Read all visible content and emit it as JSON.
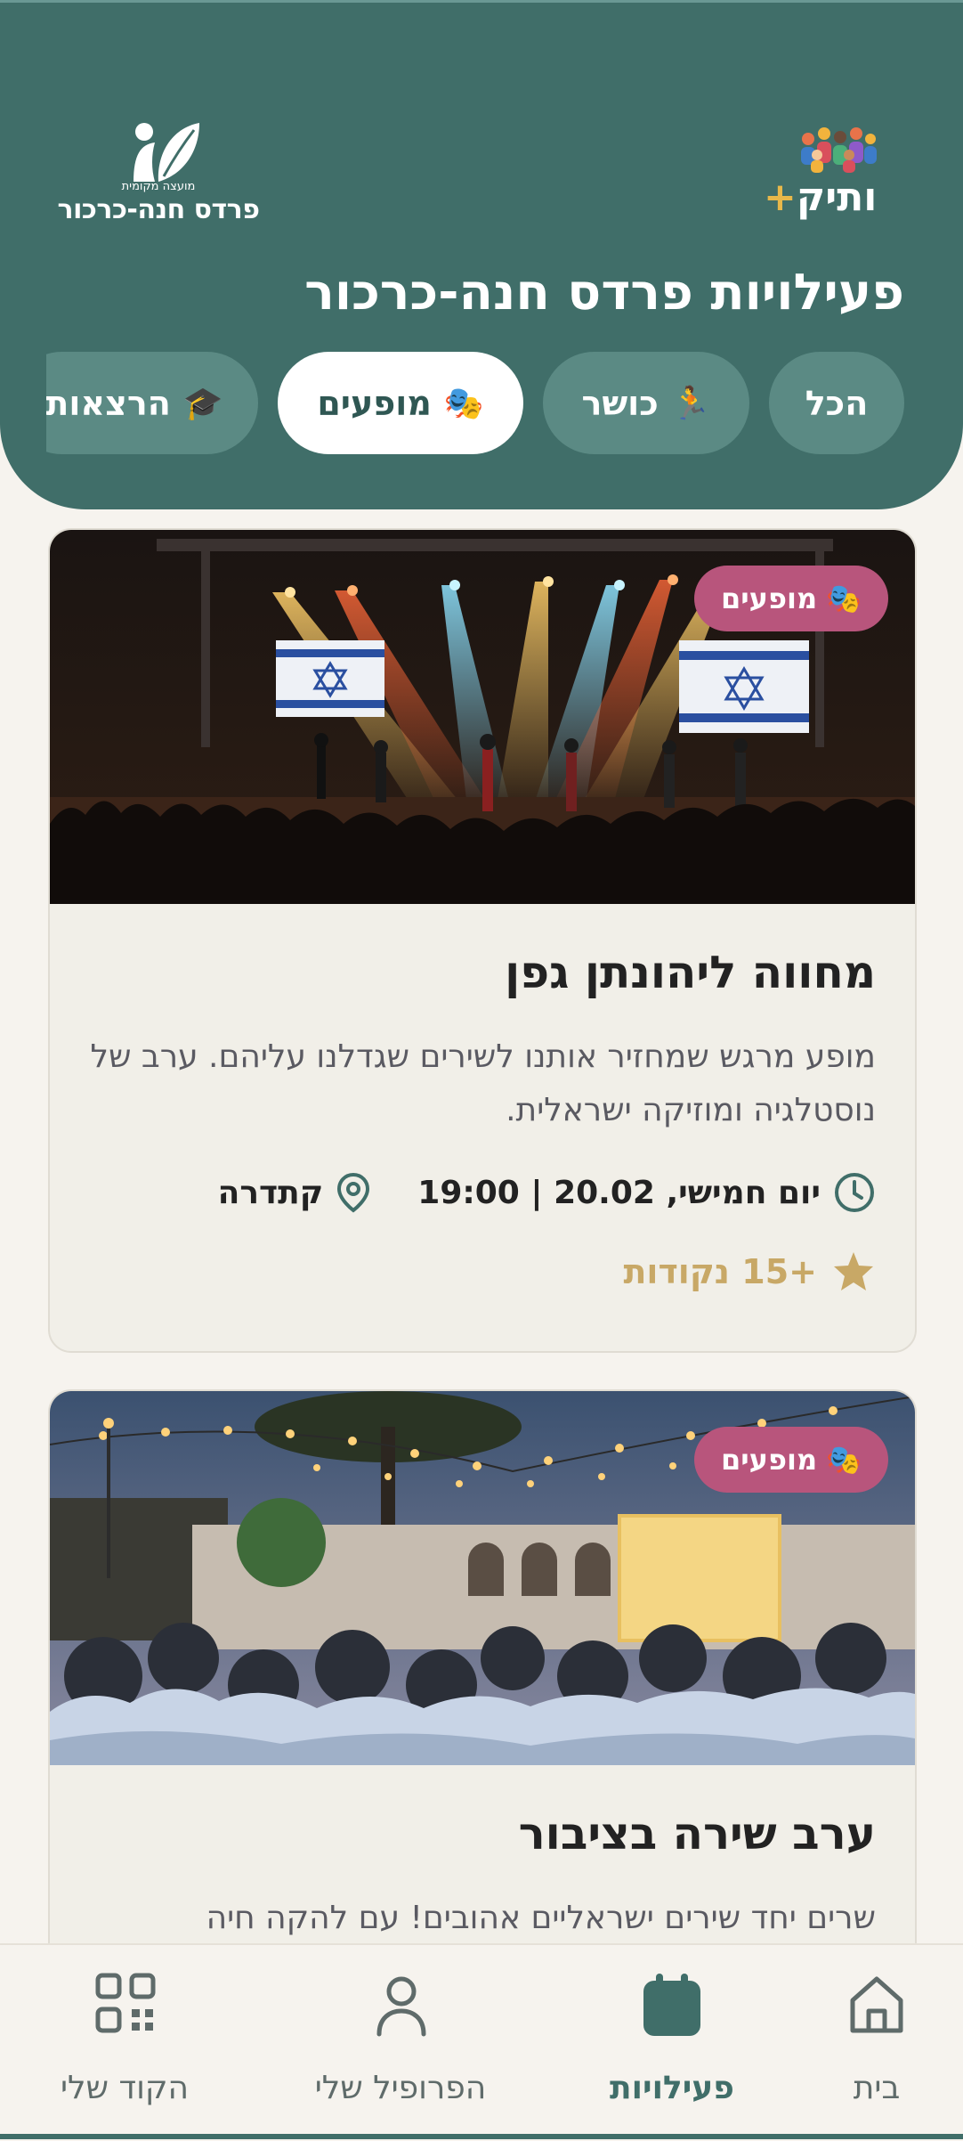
{
  "header": {
    "title": "פעילויות פרדס חנה-כרכור",
    "logo_vatik": {
      "text": "ותיק",
      "plus": "+"
    },
    "logo_council": {
      "small_text": "מועצה מקומית",
      "name": "פרדס חנה-כרכור"
    }
  },
  "filters": [
    {
      "label": "הכל",
      "icon": "",
      "active": false
    },
    {
      "label": "כושר",
      "icon": "🏃",
      "active": false
    },
    {
      "label": "מופעים",
      "icon": "🎭",
      "active": true
    },
    {
      "label": "הרצאות",
      "icon": "🎓",
      "active": false
    }
  ],
  "events": [
    {
      "badge_icon": "🎭",
      "badge": "מופעים",
      "title": "מחווה ליהונתן גפן",
      "description": "מופע מרגש שמחזיר אותנו לשירים שגדלנו עליהם. ערב של נוסטלגיה ומוזיקה ישראלית.",
      "datetime": "יום חמישי, 20.02 | 19:00",
      "location": "קתדרה",
      "points": "+15 נקודות"
    },
    {
      "badge_icon": "🎭",
      "badge": "מופעים",
      "title": "ערב שירה בציבור",
      "description": "שרים יחד שירים ישראליים אהובים! עם להקה חיה"
    }
  ],
  "nav": {
    "home": "בית",
    "activities": "פעילויות",
    "profile": "הפרופיל שלי",
    "code": "הקוד שלי"
  },
  "colors": {
    "header_bg": "#406e69",
    "badge_bg": "#b8557c",
    "points": "#c8a866",
    "background": "#f6f3ee"
  }
}
